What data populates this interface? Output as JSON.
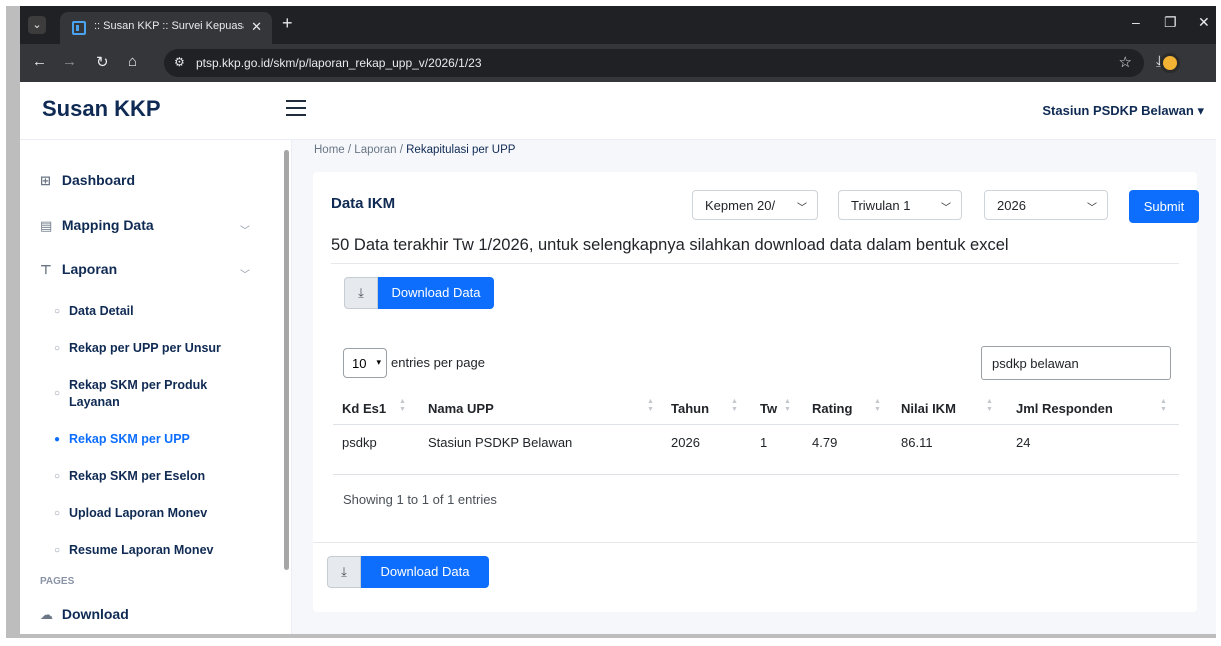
{
  "browser": {
    "tab_title": ":: Susan KKP :: Survei Kepuasan",
    "url": "ptsp.kkp.go.id/skm/p/laporan_rekap_upp_v/2026/1/23"
  },
  "app": {
    "brand": "Susan KKP",
    "user": "Stasiun PSDKP Belawan ▾"
  },
  "sidebar": {
    "items": [
      {
        "label": "Dashboard",
        "icon": "⊞"
      },
      {
        "label": "Mapping Data",
        "icon": "▤"
      },
      {
        "label": "Laporan",
        "icon": "⊤"
      }
    ],
    "submenu": [
      {
        "label": "Data Detail"
      },
      {
        "label": "Rekap per UPP per Unsur"
      },
      {
        "label": "Rekap SKM per Produk Layanan"
      },
      {
        "label": "Rekap SKM per UPP"
      },
      {
        "label": "Rekap SKM per Eselon"
      },
      {
        "label": "Upload Laporan Monev"
      },
      {
        "label": "Resume Laporan Monev"
      }
    ],
    "section_label": "PAGES",
    "download_label": "Download"
  },
  "breadcrumb": {
    "home": "Home",
    "sep": "/",
    "laporan": "Laporan",
    "current": "Rekapitulasi per UPP"
  },
  "card": {
    "title": "Data IKM",
    "filters": {
      "kepmen": "Kepmen 20/",
      "triwulan": "Triwulan 1",
      "year": "2026"
    },
    "submit_label": "Submit",
    "info": "50 Data terakhir Tw 1/2026, untuk selengkapnya silahkan download data dalam bentuk excel",
    "download_label": "Download Data",
    "per_page": "10",
    "per_page_label": "entries per page",
    "search_value": "psdkp belawan",
    "columns": [
      "Kd Es1",
      "Nama UPP",
      "Tahun",
      "Tw",
      "Rating",
      "Nilai IKM",
      "Jml Responden"
    ],
    "rows": [
      [
        "psdkp",
        "Stasiun PSDKP Belawan",
        "2026",
        "1",
        "4.79",
        "86.11",
        "24"
      ]
    ],
    "showing": "Showing 1 to 1 of 1 entries"
  }
}
